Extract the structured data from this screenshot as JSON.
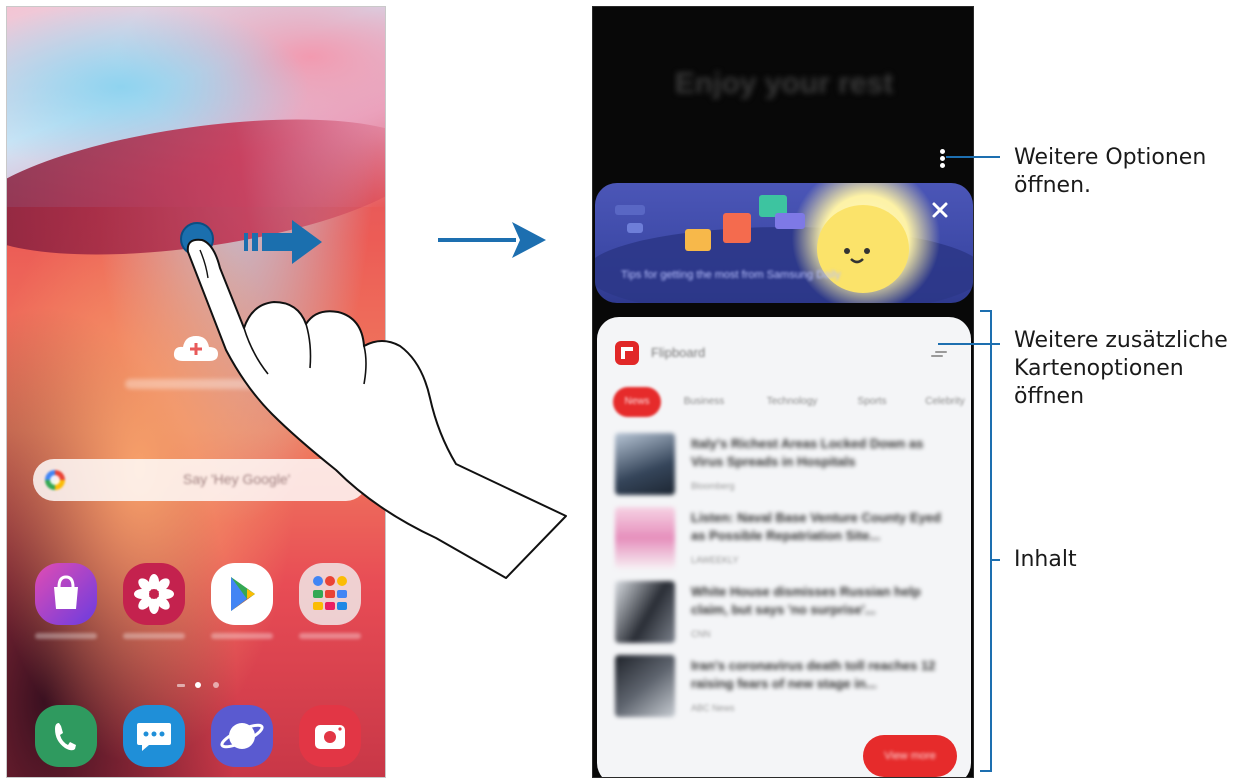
{
  "home_screen": {
    "search_placeholder": "Say 'Hey Google'",
    "apps_row": [
      {
        "name": "Galaxy Store",
        "icon": "shopping-bag-icon",
        "color": "#8b3bd6"
      },
      {
        "name": "Gallery",
        "icon": "flower-icon",
        "color": "#c4224e"
      },
      {
        "name": "Play Store",
        "icon": "play-store-icon",
        "color": "#ffffff"
      },
      {
        "name": "Google",
        "icon": "google-folder-icon",
        "color": "#f0ede8"
      }
    ],
    "dock": [
      {
        "icon": "phone-icon",
        "color": "#2f9a5f"
      },
      {
        "icon": "messages-icon",
        "color": "#1f8fd8"
      },
      {
        "icon": "internet-icon",
        "color": "#5a5ad0"
      },
      {
        "icon": "camera-icon",
        "color": "#e23645"
      }
    ]
  },
  "bixby_home": {
    "title": "Enjoy your rest",
    "promo_caption": "Tips for getting the most from Samsung Daily",
    "card": {
      "app_name": "Flipboard",
      "chips": [
        "News",
        "Business",
        "Technology",
        "Sports",
        "Celebrity"
      ],
      "articles": [
        {
          "title": "Italy's Richest Areas Locked Down as Virus Spreads in Hospitals",
          "source": "Bloomberg"
        },
        {
          "title": "Listen: Naval Base Venture County Eyed as Possible Repatriation Site...",
          "source": "LAWEEKLY"
        },
        {
          "title": "White House dismisses Russian help claim, but says 'no surprise'...",
          "source": "CNN"
        },
        {
          "title": "Iran's coronavirus death toll reaches 12 raising fears of new stage in...",
          "source": "ABC News"
        }
      ],
      "view_more_label": "View more"
    }
  },
  "callouts": {
    "more_options": "Weitere Optionen\nöffnen.",
    "card_options": "Weitere zusätzliche\nKartenoptionen\nöffnen",
    "content": "Inhalt"
  },
  "colors": {
    "accent_blue": "#1d6fb0",
    "flipboard_red": "#e62b2b"
  }
}
